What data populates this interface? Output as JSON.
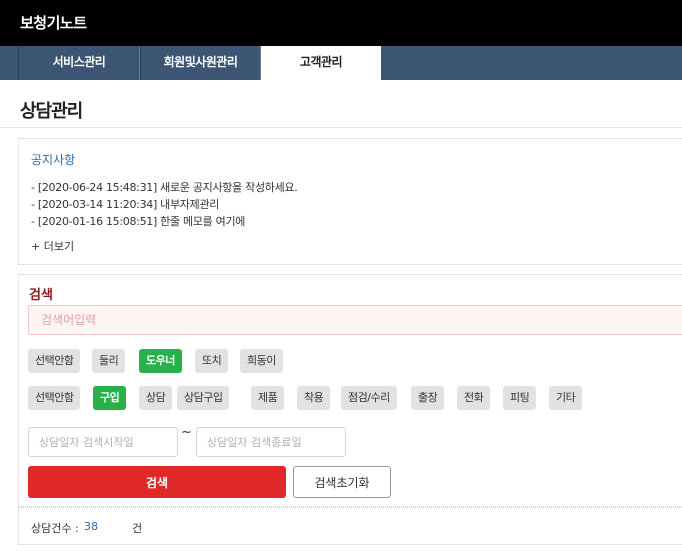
{
  "app": {
    "title": "보청기노트"
  },
  "tabs": [
    {
      "label": "서비스관리",
      "active": false
    },
    {
      "label": "회원및사원관리",
      "active": false
    },
    {
      "label": "고객관리",
      "active": true
    }
  ],
  "page": {
    "title": "상담관리"
  },
  "notice": {
    "title": "공지사항",
    "items": [
      "- [2020-06-24 15:48:31] 새로운 공지사항을 작성하세요.",
      "- [2020-03-14 11:20:34] 내부자제관리",
      "- [2020-01-16 15:08:51] 한줄 메모를 여기에"
    ],
    "more": "+ 더보기"
  },
  "search": {
    "label": "검색",
    "keyword_placeholder": "검색어입력",
    "keyword_value": "",
    "staff_filters": [
      {
        "label": "선택안함",
        "selected": false
      },
      {
        "label": "둘리",
        "selected": false
      },
      {
        "label": "도우너",
        "selected": true
      },
      {
        "label": "또치",
        "selected": false
      },
      {
        "label": "희동이",
        "selected": false
      }
    ],
    "type_filters": [
      {
        "label": "선택안함",
        "selected": false
      },
      {
        "label": "구입",
        "selected": true
      },
      {
        "label": "상담",
        "selected": false
      },
      {
        "label": "상담구입",
        "selected": false
      },
      {
        "label": "제품",
        "selected": false
      },
      {
        "label": "착용",
        "selected": false
      },
      {
        "label": "점검/수리",
        "selected": false
      },
      {
        "label": "출장",
        "selected": false
      },
      {
        "label": "전화",
        "selected": false
      },
      {
        "label": "피팅",
        "selected": false
      },
      {
        "label": "기타",
        "selected": false
      }
    ],
    "date_start_placeholder": "상담일자 검색시작일",
    "date_end_placeholder": "상담일자 검색종료일",
    "tilde": "~",
    "search_button": "검색",
    "reset_button": "검색초기화"
  },
  "result": {
    "count_label": "상담건수 :",
    "count": "38",
    "unit": "건"
  },
  "colors": {
    "topbar": "#000000",
    "tabbar": "#3b5573",
    "selected_chip": "#28b04a",
    "search_button": "#e02828",
    "notice_link": "#2a6db0"
  }
}
